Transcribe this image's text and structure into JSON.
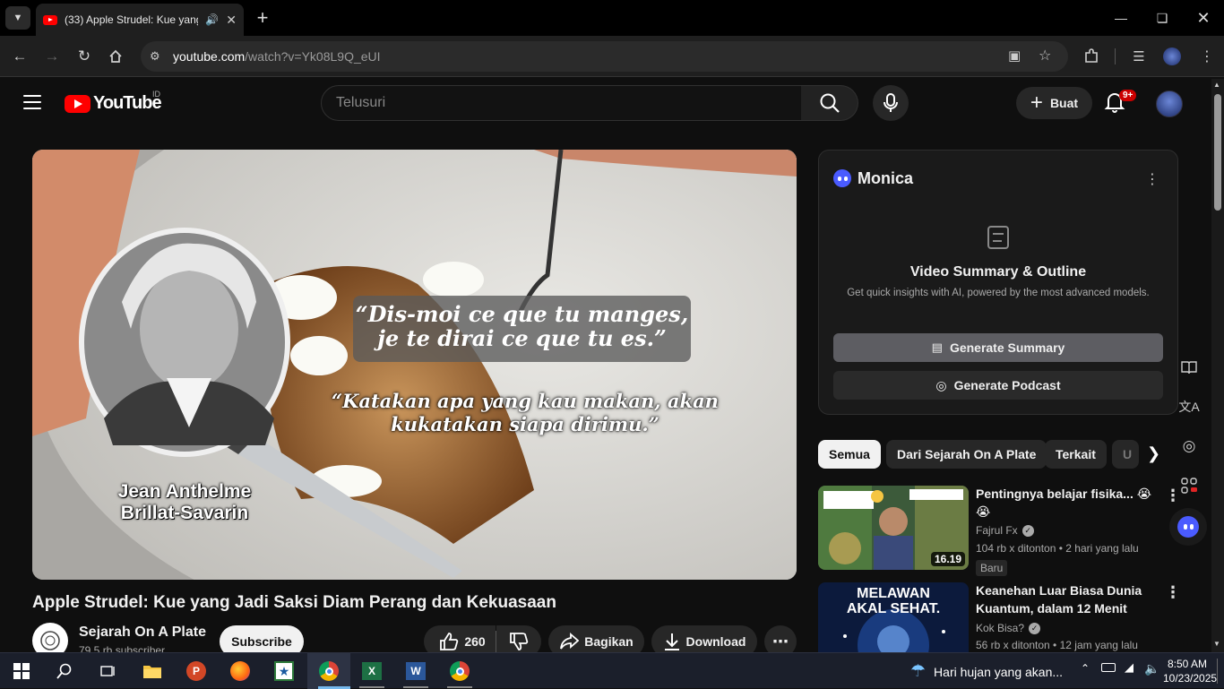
{
  "browser": {
    "tab_title": "(33) Apple Strudel: Kue yang Jadi Saksi Diam Perang dan Kekuasaan",
    "url_host": "youtube.com",
    "url_path": "/watch?v=Yk08L9Q_eUI"
  },
  "header": {
    "logo_text": "YouTube",
    "country_code": "ID",
    "search_placeholder": "Telusuri",
    "create_label": "Buat",
    "notif_count": "9+"
  },
  "video": {
    "overlay_quote_fr_1": "“Dis-moi ce que tu manges,",
    "overlay_quote_fr_2": "je te dirai ce que tu es.”",
    "overlay_quote_id_1": "“Katakan apa yang kau makan, akan",
    "overlay_quote_id_2": "kukatakan siapa dirimu.”",
    "overlay_name_1": "Jean Anthelme",
    "overlay_name_2": "Brillat-Savarin",
    "title": "Apple Strudel: Kue yang Jadi Saksi Diam Perang dan Kekuasaan",
    "channel": "Sejarah On A Plate",
    "subscribers": "79,5 rb subscriber",
    "subscribe_label": "Subscribe",
    "likes": "260",
    "share_label": "Bagikan",
    "download_label": "Download"
  },
  "monica": {
    "title": "Monica",
    "heading": "Video Summary & Outline",
    "subtitle": "Get quick insights with AI, powered by the most advanced models.",
    "summary_btn": "Generate Summary",
    "podcast_btn": "Generate Podcast"
  },
  "chips": [
    "Semua",
    "Dari Sejarah On A Plate",
    "Terkait",
    "U"
  ],
  "recommendations": [
    {
      "title": "Pentingnya belajar fisika... 😭😭",
      "channel": "Fajrul Fx",
      "meta": "104 rb x ditonton • 2 hari yang lalu",
      "duration": "16.19",
      "badge": "Baru"
    },
    {
      "title": "Keanehan Luar Biasa Dunia Kuantum, dalam 12 Menit",
      "channel": "Kok Bisa?",
      "meta": "56 rb x ditonton • 12 jam yang lalu",
      "thumb_text_1": "MELAWAN",
      "thumb_text_2": "AKAL SEHAT."
    }
  ],
  "taskbar": {
    "weather": "Hari hujan yang akan...",
    "time": "8:50 AM",
    "date": "10/23/2025"
  },
  "colors": {
    "yt_red": "#ff0000",
    "background": "#0f0f0f",
    "monica_blue": "#4a5bff"
  }
}
